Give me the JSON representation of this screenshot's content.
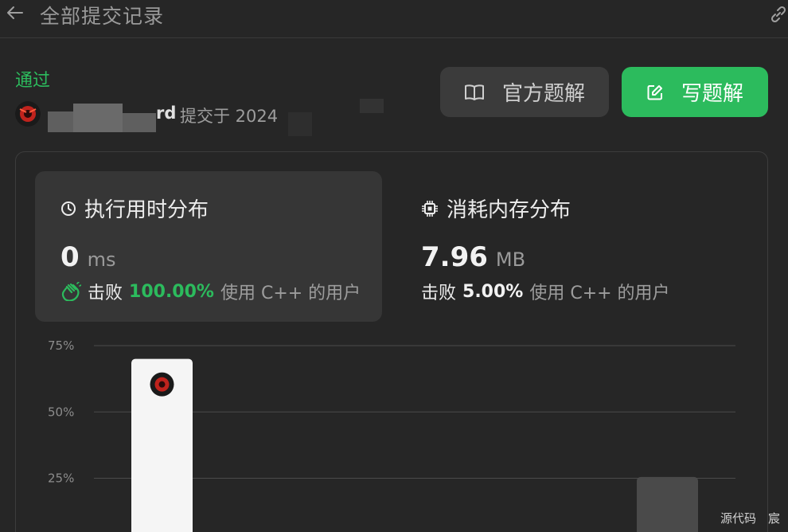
{
  "header": {
    "title": "全部提交记录"
  },
  "result": {
    "status": "通过",
    "username_tail": "rd",
    "submitted_at_prefix": "提交于 2024"
  },
  "actions": {
    "official_solution": "官方题解",
    "write_solution": "写题解"
  },
  "runtime": {
    "title": "执行用时分布",
    "value": "0",
    "unit": "ms",
    "beats_label": "击败",
    "beats_percent": "100.00%",
    "beats_tail": "使用 C++ 的用户",
    "accent": "#2cbb5d"
  },
  "memory": {
    "title": "消耗内存分布",
    "value": "7.96",
    "unit": "MB",
    "beats_label": "击败",
    "beats_percent": "5.00%",
    "beats_tail": "使用 C++ 的用户"
  },
  "chart_data": {
    "type": "bar",
    "ylim": [
      0,
      80
    ],
    "y_ticks": [
      {
        "label": "75%",
        "value": 75
      },
      {
        "label": "50%",
        "value": 50
      },
      {
        "label": "25%",
        "value": 25
      }
    ],
    "bars": [
      {
        "value": 70,
        "highlight": true
      },
      {
        "value": 25.5,
        "highlight": false
      }
    ],
    "grid": true
  },
  "watermark": "源代码　宸"
}
